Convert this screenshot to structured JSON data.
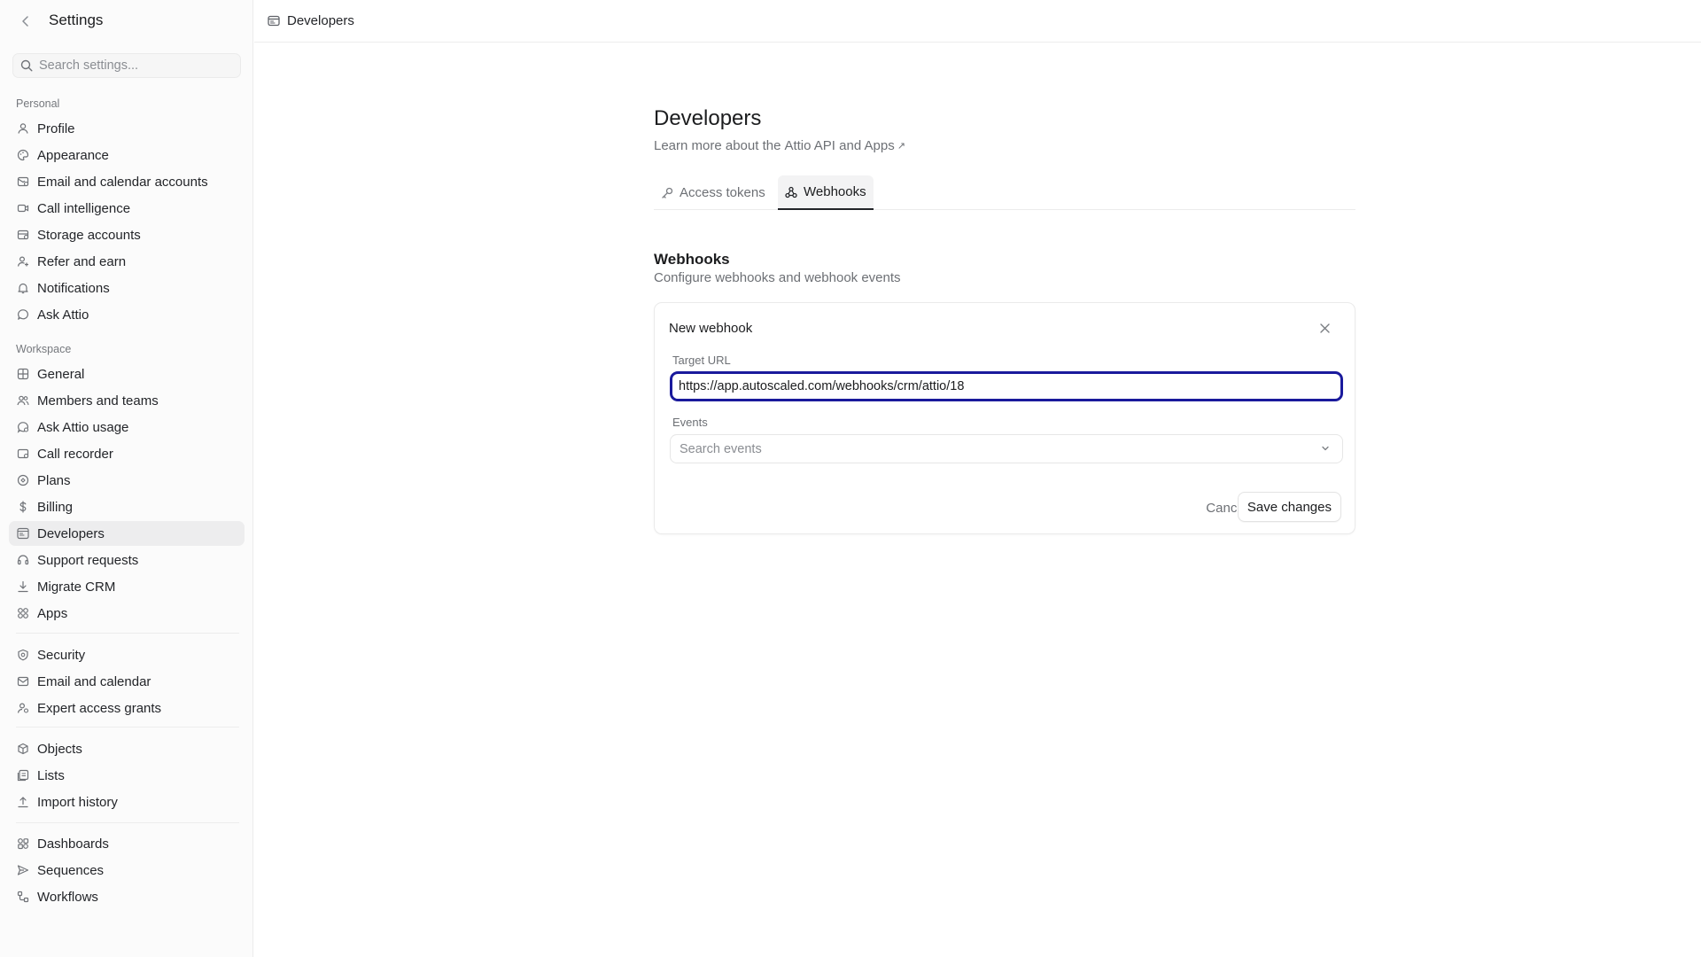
{
  "sidebar": {
    "title": "Settings",
    "search_placeholder": "Search settings...",
    "groups": {
      "personal_label": "Personal",
      "workspace_label": "Workspace"
    },
    "personal": [
      {
        "label": "Profile",
        "icon": "user-icon"
      },
      {
        "label": "Appearance",
        "icon": "palette-icon"
      },
      {
        "label": "Email and calendar accounts",
        "icon": "mail-calendar-icon"
      },
      {
        "label": "Call intelligence",
        "icon": "video-icon"
      },
      {
        "label": "Storage accounts",
        "icon": "storage-icon"
      },
      {
        "label": "Refer and earn",
        "icon": "user-plus-icon"
      },
      {
        "label": "Notifications",
        "icon": "bell-icon"
      },
      {
        "label": "Ask Attio",
        "icon": "chat-icon"
      }
    ],
    "workspace": [
      {
        "label": "General",
        "icon": "grid-icon"
      },
      {
        "label": "Members and teams",
        "icon": "users-icon"
      },
      {
        "label": "Ask Attio usage",
        "icon": "chat-gauge-icon"
      },
      {
        "label": "Call recorder",
        "icon": "recorder-icon"
      },
      {
        "label": "Plans",
        "icon": "badge-icon"
      },
      {
        "label": "Billing",
        "icon": "dollar-icon"
      },
      {
        "label": "Developers",
        "icon": "browser-icon"
      },
      {
        "label": "Support requests",
        "icon": "headset-icon"
      },
      {
        "label": "Migrate CRM",
        "icon": "download-icon"
      },
      {
        "label": "Apps",
        "icon": "apps-icon"
      }
    ],
    "security_group": [
      {
        "label": "Security",
        "icon": "shield-icon"
      },
      {
        "label": "Email and calendar",
        "icon": "envelope-icon"
      },
      {
        "label": "Expert access grants",
        "icon": "user-key-icon"
      }
    ],
    "data_group": [
      {
        "label": "Objects",
        "icon": "cube-icon"
      },
      {
        "label": "Lists",
        "icon": "list-icon"
      },
      {
        "label": "Import history",
        "icon": "upload-icon"
      }
    ],
    "automation_group": [
      {
        "label": "Dashboards",
        "icon": "dashboard-icon"
      },
      {
        "label": "Sequences",
        "icon": "send-icon"
      },
      {
        "label": "Workflows",
        "icon": "workflow-icon"
      }
    ],
    "active_item": "Developers"
  },
  "topbar": {
    "breadcrumb": "Developers"
  },
  "main": {
    "title": "Developers",
    "subtitle_prefix": "Learn more about the",
    "subtitle_link": "Attio API and Apps",
    "tabs": [
      {
        "label": "Access tokens",
        "icon": "key-icon",
        "active": false
      },
      {
        "label": "Webhooks",
        "icon": "webhook-icon",
        "active": true
      }
    ],
    "section_title": "Webhooks",
    "section_subtitle": "Configure webhooks and webhook events",
    "card": {
      "title": "New webhook",
      "target_url_label": "Target URL",
      "target_url_value": "https://app.autoscaled.com/webhooks/crm/attio/18",
      "events_label": "Events",
      "events_placeholder": "Search events",
      "cancel_label": "Cancel",
      "save_label": "Save changes"
    }
  },
  "colors": {
    "focus_ring": "#1a1a9c",
    "active_nav_bg": "#ededee",
    "sidebar_bg": "#fbfbfb"
  }
}
